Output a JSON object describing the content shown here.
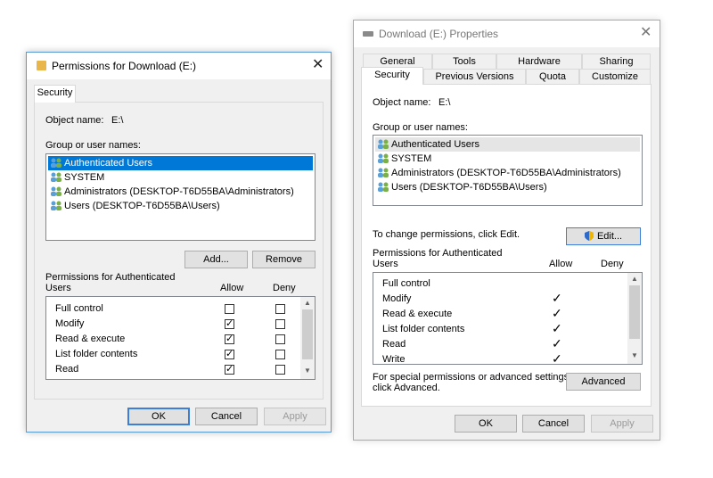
{
  "perm_dialog": {
    "title": "Permissions for Download (E:)",
    "tab": "Security",
    "object_label": "Object name:",
    "object_value": "E:\\",
    "group_label": "Group or user names:",
    "users": [
      "Authenticated Users",
      "SYSTEM",
      "Administrators (DESKTOP-T6D55BA\\Administrators)",
      "Users (DESKTOP-T6D55BA\\Users)"
    ],
    "add_label": "Add...",
    "remove_label": "Remove",
    "perms_for_line1": "Permissions for Authenticated",
    "perms_for_line2": "Users",
    "allow_header": "Allow",
    "deny_header": "Deny",
    "permissions": [
      {
        "name": "Full control",
        "allow": false,
        "deny": false
      },
      {
        "name": "Modify",
        "allow": true,
        "deny": false
      },
      {
        "name": "Read & execute",
        "allow": true,
        "deny": false
      },
      {
        "name": "List folder contents",
        "allow": true,
        "deny": false
      },
      {
        "name": "Read",
        "allow": true,
        "deny": false
      }
    ],
    "ok_label": "OK",
    "cancel_label": "Cancel",
    "apply_label": "Apply"
  },
  "props_dialog": {
    "title": "Download (E:) Properties",
    "tabs_row1": [
      "General",
      "Tools",
      "Hardware",
      "Sharing"
    ],
    "tabs_row2": [
      "Security",
      "Previous Versions",
      "Quota",
      "Customize"
    ],
    "active_tab": "Security",
    "object_label": "Object name:",
    "object_value": "E:\\",
    "group_label": "Group or user names:",
    "users": [
      "Authenticated Users",
      "SYSTEM",
      "Administrators (DESKTOP-T6D55BA\\Administrators)",
      "Users (DESKTOP-T6D55BA\\Users)"
    ],
    "change_text": "To change permissions, click Edit.",
    "edit_label": "Edit...",
    "perms_for_line1": "Permissions for Authenticated",
    "perms_for_line2": "Users",
    "allow_header": "Allow",
    "deny_header": "Deny",
    "permissions": [
      {
        "name": "Full control",
        "allow": false
      },
      {
        "name": "Modify",
        "allow": true
      },
      {
        "name": "Read & execute",
        "allow": true
      },
      {
        "name": "List folder contents",
        "allow": true
      },
      {
        "name": "Read",
        "allow": true
      },
      {
        "name": "Write",
        "allow": true
      }
    ],
    "special_line1": "For special permissions or advanced settings,",
    "special_line2": "click Advanced.",
    "advanced_label": "Advanced",
    "ok_label": "OK",
    "cancel_label": "Cancel",
    "apply_label": "Apply"
  },
  "colors": {
    "accent": "#0078d7",
    "dialog_bg": "#f0f0f0",
    "default_button_border": "#3c7fd8"
  }
}
